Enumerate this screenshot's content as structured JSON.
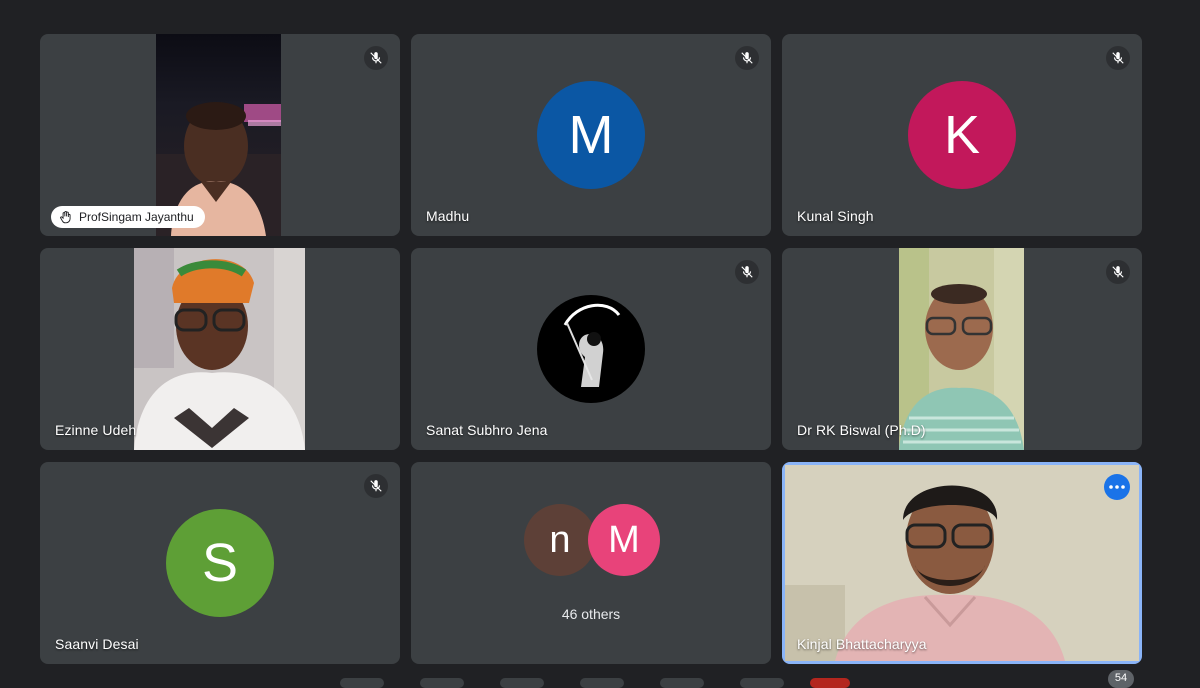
{
  "participants": {
    "jayanthu": {
      "name": "ProfSingam Jayanthu"
    },
    "madhu": {
      "name": "Madhu",
      "initial": "M",
      "color": "#0b57a4"
    },
    "kunal": {
      "name": "Kunal Singh",
      "initial": "K",
      "color": "#c2185b"
    },
    "ezinne": {
      "name": "Ezinne Udeh"
    },
    "sanat": {
      "name": "Sanat Subhro Jena"
    },
    "biswal": {
      "name": "Dr RK Biswal (Ph.D)"
    },
    "saanvi": {
      "name": "Saanvi Desai",
      "initial": "S",
      "color": "#5e9f36"
    },
    "others": {
      "label": "46 others",
      "initial_1": "n",
      "color_1": "#5d4037",
      "initial_2": "M",
      "color_2": "#e8437a"
    },
    "kinjal": {
      "name": "Kinjal Bhattacharyya"
    }
  },
  "participant_count": "54",
  "icons": {
    "mic_off": "mic-off-icon",
    "raised_hand": "raised-hand-icon",
    "more_options": "more-options-icon"
  },
  "colors": {
    "background": "#202124",
    "tile": "#3c4043",
    "active_border": "#8ab4f8",
    "accent": "#1a73e8"
  }
}
